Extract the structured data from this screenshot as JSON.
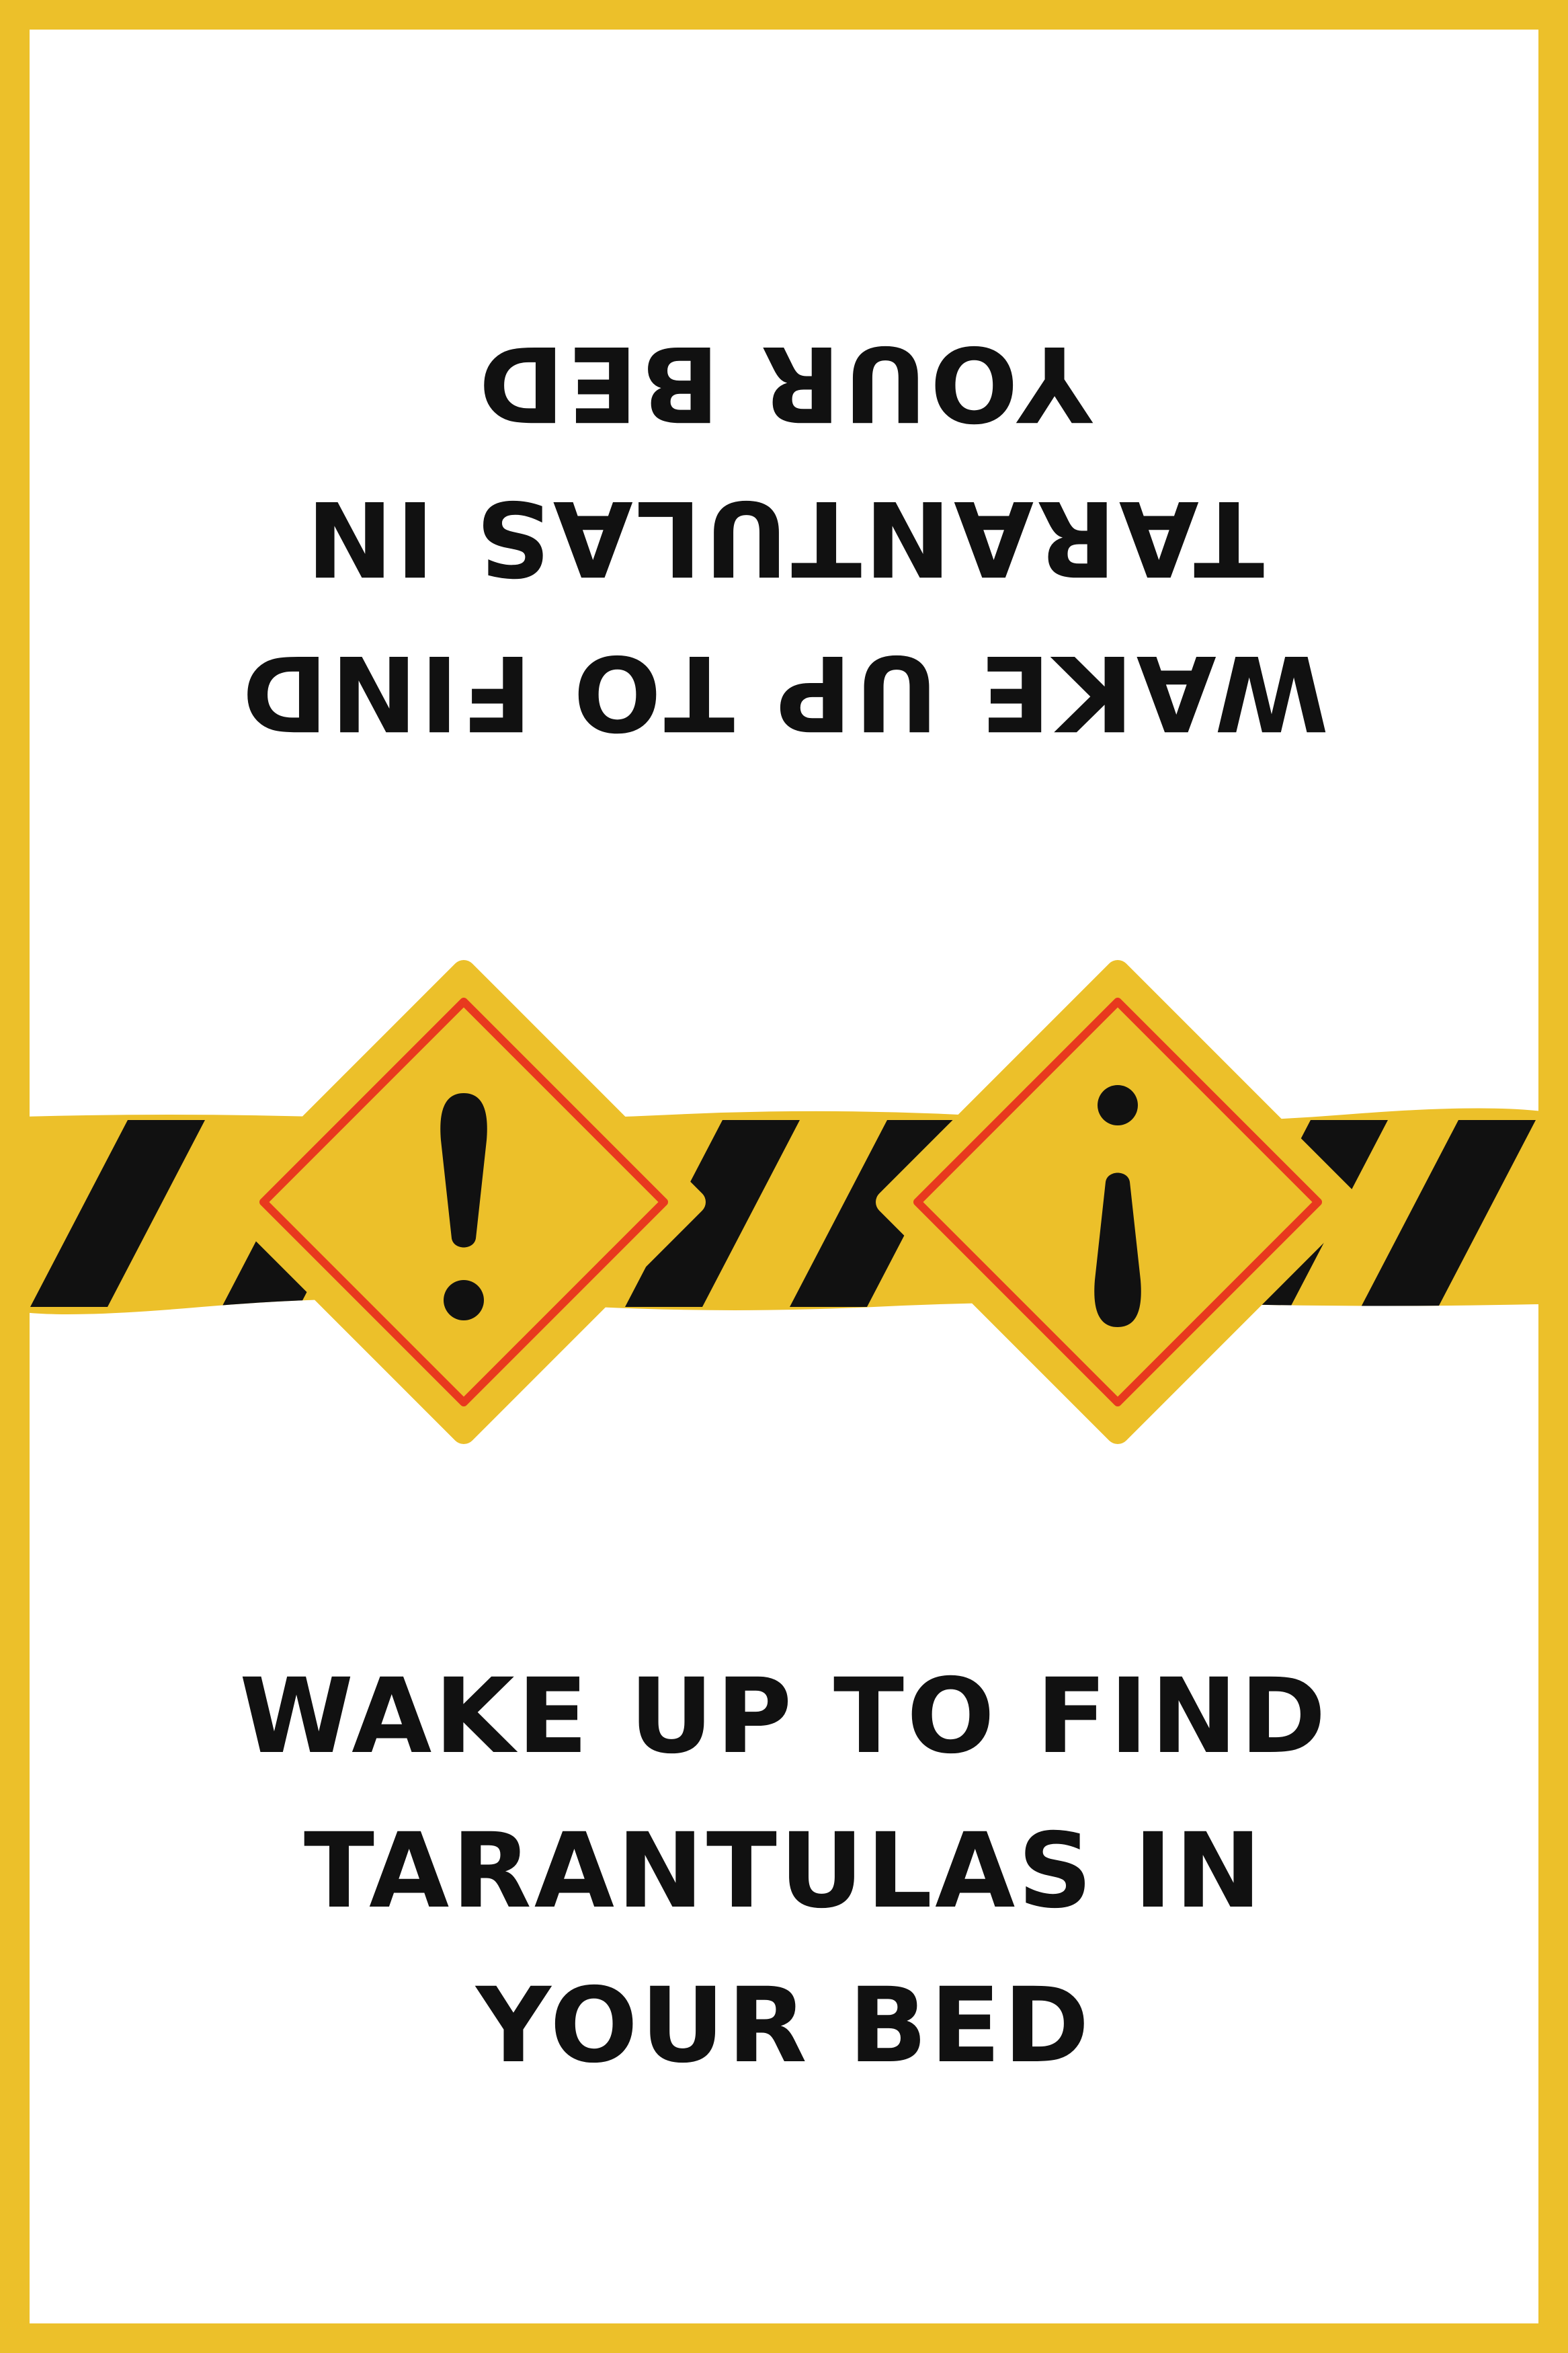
{
  "message_top": {
    "lines": [
      "WAKE UP TO FIND",
      "TARANTULAS IN",
      "YOUR BED"
    ]
  },
  "message_bottom": {
    "lines": [
      "WAKE UP TO FIND",
      "TARANTULAS IN",
      "YOUR BED"
    ]
  },
  "graphic": {
    "left_sign_icon": "exclamation-mark",
    "right_sign_icon": "inverted-exclamation-mark"
  },
  "colors": {
    "frame": "#ECC02A",
    "tape": "#ECC02A",
    "stripe": "#111111",
    "sign_border": "#E8391E",
    "text": "#111111",
    "background": "#FFFFFF"
  }
}
